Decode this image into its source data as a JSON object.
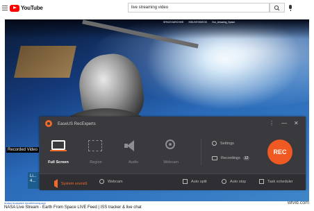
{
  "header": {
    "logo_text": "YouTube",
    "search_value": "live streaming video"
  },
  "video": {
    "overlay_handles": [
      "SPACEXARCHIVE",
      "ISSLIVEVIDEOS",
      "Our_Amazing_Space"
    ],
    "recorded_label": "Recorded Video",
    "live_chip_text": "Li... 4..."
  },
  "recorder": {
    "title": "EaseUS RecExperts",
    "controls": {
      "more": "⋮",
      "minimize": "—",
      "close": "✕"
    },
    "modes": [
      {
        "label": "Full Screen",
        "icon": "fullscreen-icon",
        "active": true
      },
      {
        "label": "Region",
        "icon": "region-icon",
        "active": false
      },
      {
        "label": "Audio",
        "icon": "audio-icon",
        "active": false
      },
      {
        "label": "Webcam",
        "icon": "webcam-icon",
        "active": false
      }
    ],
    "settings_label": "Settings",
    "recordings_label": "Recordings",
    "recordings_count": "12",
    "rec_label": "REC",
    "bottom": {
      "system_sound": "System sound1",
      "webcam": "Webcam",
      "auto_split": "Auto split",
      "auto_stop": "Auto stop",
      "task_scheduler": "Task scheduler"
    },
    "accent_color": "#f05a22"
  },
  "footer": {
    "tags": "#nasa #nasalive #earthfromspace",
    "video_title": "NASA Live Stream - Earth From Space LIVE Feed | ISS tracker & live chat",
    "watermark": "wtvid.com"
  }
}
